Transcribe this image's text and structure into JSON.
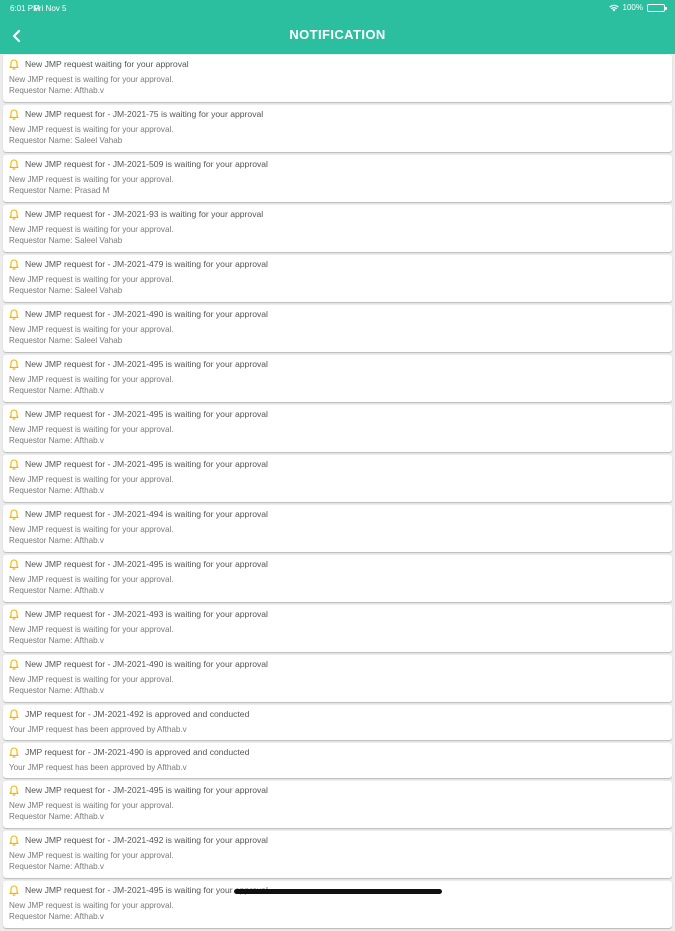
{
  "status_bar": {
    "time": "6:01 PM",
    "date": "Fri Nov 5",
    "battery": "100%"
  },
  "header": {
    "title": "NOTIFICATION",
    "back_icon": "chevron-left-icon",
    "background_color": "#2cbf9f",
    "text_color": "#ffffff"
  },
  "notification_icon": "bell-icon",
  "notification_icon_color": "#f5b400",
  "notifications": [
    {
      "title": "New JMP request waiting for your approval",
      "description": "New JMP request is waiting for your approval.",
      "requestor": "Requestor Name: Afthab.v"
    },
    {
      "title": "New JMP request for - JM-2021-75 is waiting for your approval",
      "description": "New JMP request is waiting for your approval.",
      "requestor": "Requestor Name: Saleel Vahab"
    },
    {
      "title": "New JMP request for - JM-2021-509 is waiting for your approval",
      "description": "New JMP request is waiting for your approval.",
      "requestor": "Requestor Name: Prasad M"
    },
    {
      "title": "New JMP request for - JM-2021-93 is waiting for your approval",
      "description": "New JMP request is waiting for your approval.",
      "requestor": "Requestor Name: Saleel Vahab"
    },
    {
      "title": "New JMP request for - JM-2021-479 is waiting for your approval",
      "description": "New JMP request is waiting for your approval.",
      "requestor": "Requestor Name: Saleel Vahab"
    },
    {
      "title": "New JMP request for - JM-2021-490 is waiting for your approval",
      "description": "New JMP request is waiting for your approval.",
      "requestor": "Requestor Name: Saleel Vahab"
    },
    {
      "title": "New JMP request for - JM-2021-495 is waiting for your approval",
      "description": "New JMP request is waiting for your approval.",
      "requestor": "Requestor Name: Afthab.v"
    },
    {
      "title": "New JMP request for - JM-2021-495 is waiting for your approval",
      "description": "New JMP request is waiting for your approval.",
      "requestor": "Requestor Name: Afthab.v"
    },
    {
      "title": "New JMP request for - JM-2021-495 is waiting for your approval",
      "description": "New JMP request is waiting for your approval.",
      "requestor": "Requestor Name: Afthab.v"
    },
    {
      "title": "New JMP request for - JM-2021-494 is waiting for your approval",
      "description": "New JMP request is waiting for your approval.",
      "requestor": "Requestor Name: Afthab.v"
    },
    {
      "title": "New JMP request for - JM-2021-495 is waiting for your approval",
      "description": "New JMP request is waiting for your approval.",
      "requestor": "Requestor Name: Afthab.v"
    },
    {
      "title": "New JMP request for - JM-2021-493 is waiting for your approval",
      "description": "New JMP request is waiting for your approval.",
      "requestor": "Requestor Name: Afthab.v"
    },
    {
      "title": "New JMP request for - JM-2021-490 is waiting for your approval",
      "description": "New JMP request is waiting for your approval.",
      "requestor": "Requestor Name: Afthab.v"
    },
    {
      "title": "JMP request for - JM-2021-492 is approved and conducted",
      "description": "Your JMP request has been  approved by Afthab.v"
    },
    {
      "title": "JMP request for - JM-2021-490 is approved and conducted",
      "description": "Your JMP request has been  approved by Afthab.v"
    },
    {
      "title": "New JMP request for - JM-2021-495 is waiting for your approval",
      "description": "New JMP request is waiting for your approval.",
      "requestor": "Requestor Name: Afthab.v"
    },
    {
      "title": "New JMP request for - JM-2021-492 is waiting for your approval",
      "description": "New JMP request is waiting for your approval.",
      "requestor": "Requestor Name: Afthab.v"
    },
    {
      "title": "New JMP request for - JM-2021-495 is waiting for your approval",
      "description": "New JMP request is waiting for your approval.",
      "requestor": "Requestor Name: Afthab.v"
    }
  ]
}
